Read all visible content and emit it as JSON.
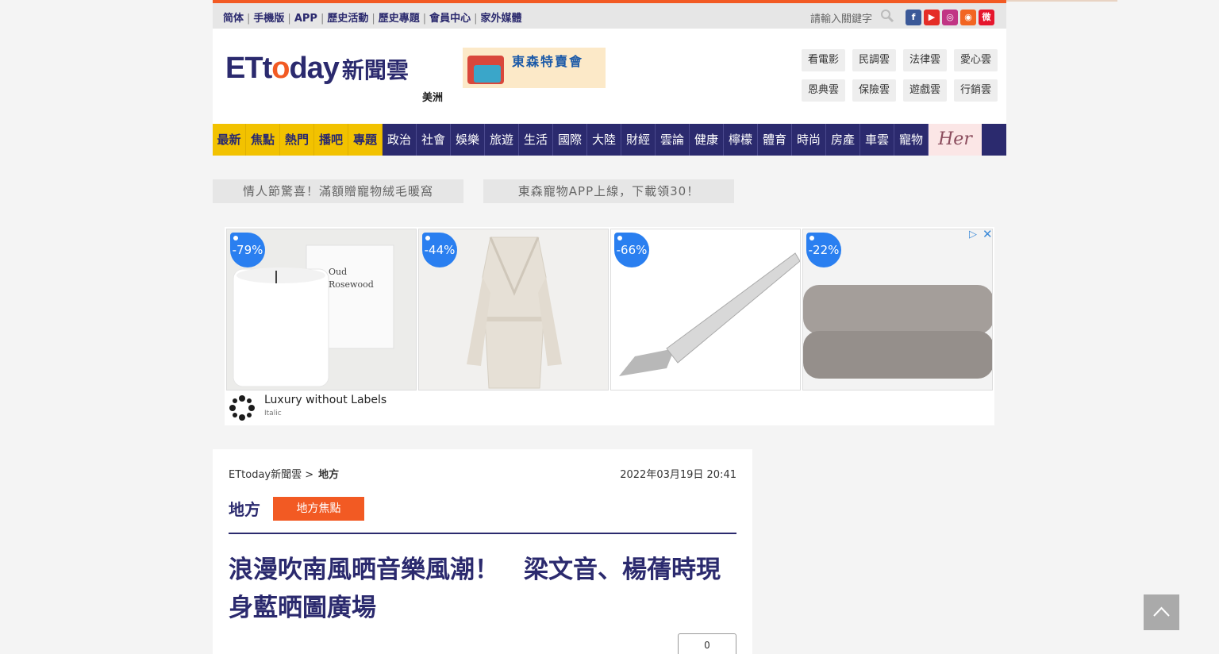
{
  "topbar": {
    "links": [
      "简体",
      "手機版",
      "APP",
      "歷史活動",
      "歷史專題",
      "會員中心",
      "家外媒體"
    ],
    "search_placeholder": "請輸入關鍵字",
    "social": [
      {
        "name": "facebook-icon",
        "glyph": "f",
        "color": "#3b5998"
      },
      {
        "name": "youtube-icon",
        "glyph": "▶",
        "color": "#e52d27"
      },
      {
        "name": "instagram-icon",
        "glyph": "◎",
        "color": "#c13584"
      },
      {
        "name": "rss-icon",
        "glyph": "◉",
        "color": "#f26522"
      },
      {
        "name": "weibo-icon",
        "glyph": "微",
        "color": "#e6162d"
      }
    ]
  },
  "header": {
    "logo": {
      "et": "ET",
      "to": "t",
      "o": "o",
      "day": "day",
      "cn": "新聞雲"
    },
    "region": "美洲",
    "promo_text": "東森特賣會",
    "clouds": [
      "看電影",
      "民調雲",
      "法律雲",
      "愛心雲",
      "恩典雲",
      "保險雲",
      "遊戲雲",
      "行銷雲"
    ]
  },
  "nav": {
    "highlight": [
      "最新",
      "焦點",
      "熱門",
      "播吧",
      "專題"
    ],
    "items": [
      "政治",
      "社會",
      "娛樂",
      "旅遊",
      "生活",
      "國際",
      "大陸",
      "財經",
      "雲論",
      "健康",
      "檸檬",
      "體育",
      "時尚",
      "房產",
      "車雲",
      "寵物"
    ],
    "her_label": "Her"
  },
  "banners": [
    "情人節驚喜！滿額贈寵物絨毛暖窩",
    "東森寵物APP上線，下載領30！"
  ],
  "ad": {
    "discounts": [
      "-79%",
      "-44%",
      "-66%",
      "-22%"
    ],
    "candle_text": [
      "Oud",
      "Rosewood"
    ],
    "brand": "Luxury without Labels",
    "sub": "Italic"
  },
  "article": {
    "breadcrumb_root": "ETtoday新聞雲 >",
    "breadcrumb_current": "地方",
    "date": "2022年03月19日 20:41",
    "section": "地方",
    "section_button": "地方焦點",
    "title": "浪漫吹南風晒音樂風潮！　梁文音、楊蒨時現身藍晒圖廣場",
    "comment_count": "0"
  },
  "colors": {
    "brand_navy": "#2b2a6e",
    "accent_orange": "#f25a23",
    "nav_yellow": "#f2c200",
    "ad_tag_blue": "#2a7ff0"
  }
}
